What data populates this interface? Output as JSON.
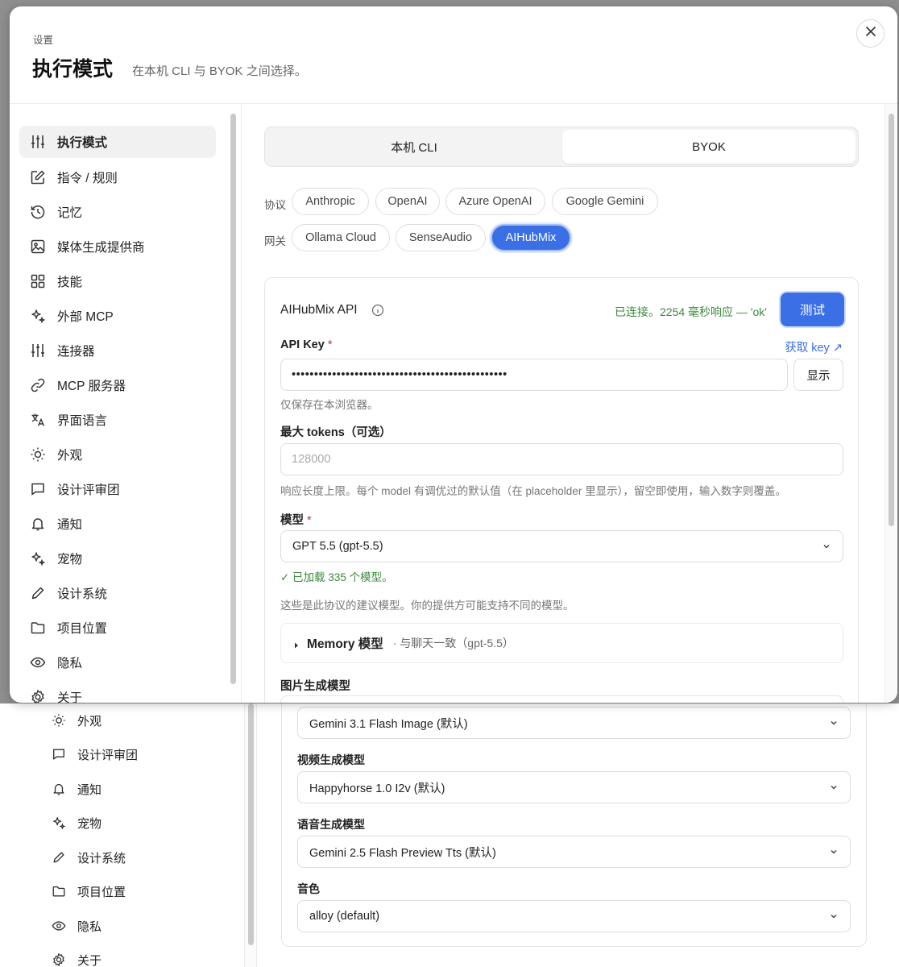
{
  "header": {
    "breadcrumb": "设置",
    "title": "执行模式",
    "subtitle": "在本机 CLI 与 BYOK 之间选择。"
  },
  "sidebar": {
    "items": [
      {
        "label": "执行模式",
        "icon": "sliders-icon",
        "active": true
      },
      {
        "label": "指令 / 规则",
        "icon": "edit-icon"
      },
      {
        "label": "记忆",
        "icon": "history-icon"
      },
      {
        "label": "媒体生成提供商",
        "icon": "image-icon"
      },
      {
        "label": "技能",
        "icon": "grid-icon"
      },
      {
        "label": "外部 MCP",
        "icon": "sparkle-icon"
      },
      {
        "label": "连接器",
        "icon": "sliders-icon"
      },
      {
        "label": "MCP 服务器",
        "icon": "link-icon"
      },
      {
        "label": "界面语言",
        "icon": "translate-icon"
      },
      {
        "label": "外观",
        "icon": "sun-icon"
      },
      {
        "label": "设计评审团",
        "icon": "chat-icon"
      },
      {
        "label": "通知",
        "icon": "bell-icon"
      },
      {
        "label": "宠物",
        "icon": "sparkle-icon"
      },
      {
        "label": "设计系统",
        "icon": "pencil-icon"
      },
      {
        "label": "项目位置",
        "icon": "folder-icon"
      },
      {
        "label": "隐私",
        "icon": "eye-icon"
      },
      {
        "label": "关于",
        "icon": "gear-icon"
      }
    ]
  },
  "mode": {
    "options": [
      "本机 CLI",
      "BYOK"
    ],
    "selected": "BYOK"
  },
  "protocol": {
    "label": "协议",
    "options": [
      "Anthropic",
      "OpenAI",
      "Azure OpenAI",
      "Google Gemini"
    ]
  },
  "gateway": {
    "label": "网关",
    "options": [
      "Ollama Cloud",
      "SenseAudio",
      "AIHubMix"
    ],
    "selected": "AIHubMix"
  },
  "api": {
    "title": "AIHubMix API",
    "status": "已连接。2254 毫秒响应 — 'ok'",
    "test_label": "测试",
    "key_label": "API Key",
    "required_mark": "*",
    "get_key_label": "获取 key ↗",
    "key_value": "••••••••••••••••••••••••••••••••••••••••••••••••",
    "show_label": "显示",
    "key_hint": "仅保存在本浏览器。",
    "max_tokens_label": "最大 tokens（可选）",
    "max_tokens_placeholder": "128000",
    "max_tokens_hint": "响应长度上限。每个 model 有调优过的默认值（在 placeholder 里显示），留空即使用，输入数字则覆盖。",
    "model_label": "模型",
    "model_value": "GPT 5.5 (gpt-5.5)",
    "models_loaded": "✓ 已加载 335 个模型。",
    "models_hint": "这些是此协议的建议模型。你的提供方可能支持不同的模型。",
    "memory_title": "Memory 模型",
    "memory_sub": "· 与聊天一致（gpt-5.5）",
    "image_model_label": "图片生成模型"
  },
  "lower": {
    "sidebar_items": [
      {
        "label": "外观",
        "icon": "sun-icon"
      },
      {
        "label": "设计评审团",
        "icon": "chat-icon"
      },
      {
        "label": "通知",
        "icon": "bell-icon"
      },
      {
        "label": "宠物",
        "icon": "sparkle-icon"
      },
      {
        "label": "设计系统",
        "icon": "pencil-icon"
      },
      {
        "label": "项目位置",
        "icon": "folder-icon"
      },
      {
        "label": "隐私",
        "icon": "eye-icon"
      },
      {
        "label": "关于",
        "icon": "gear-icon"
      }
    ],
    "image_model_value": "Gemini 3.1 Flash Image (默认)",
    "video_model_label": "视频生成模型",
    "video_model_value": "Happyhorse 1.0 I2v (默认)",
    "speech_model_label": "语音生成模型",
    "speech_model_value": "Gemini 2.5 Flash Preview Tts (默认)",
    "voice_label": "音色",
    "voice_value": "alloy (default)"
  },
  "colors": {
    "accent": "#3a6fe6",
    "success": "#3c8a3c",
    "required": "#b33333"
  }
}
